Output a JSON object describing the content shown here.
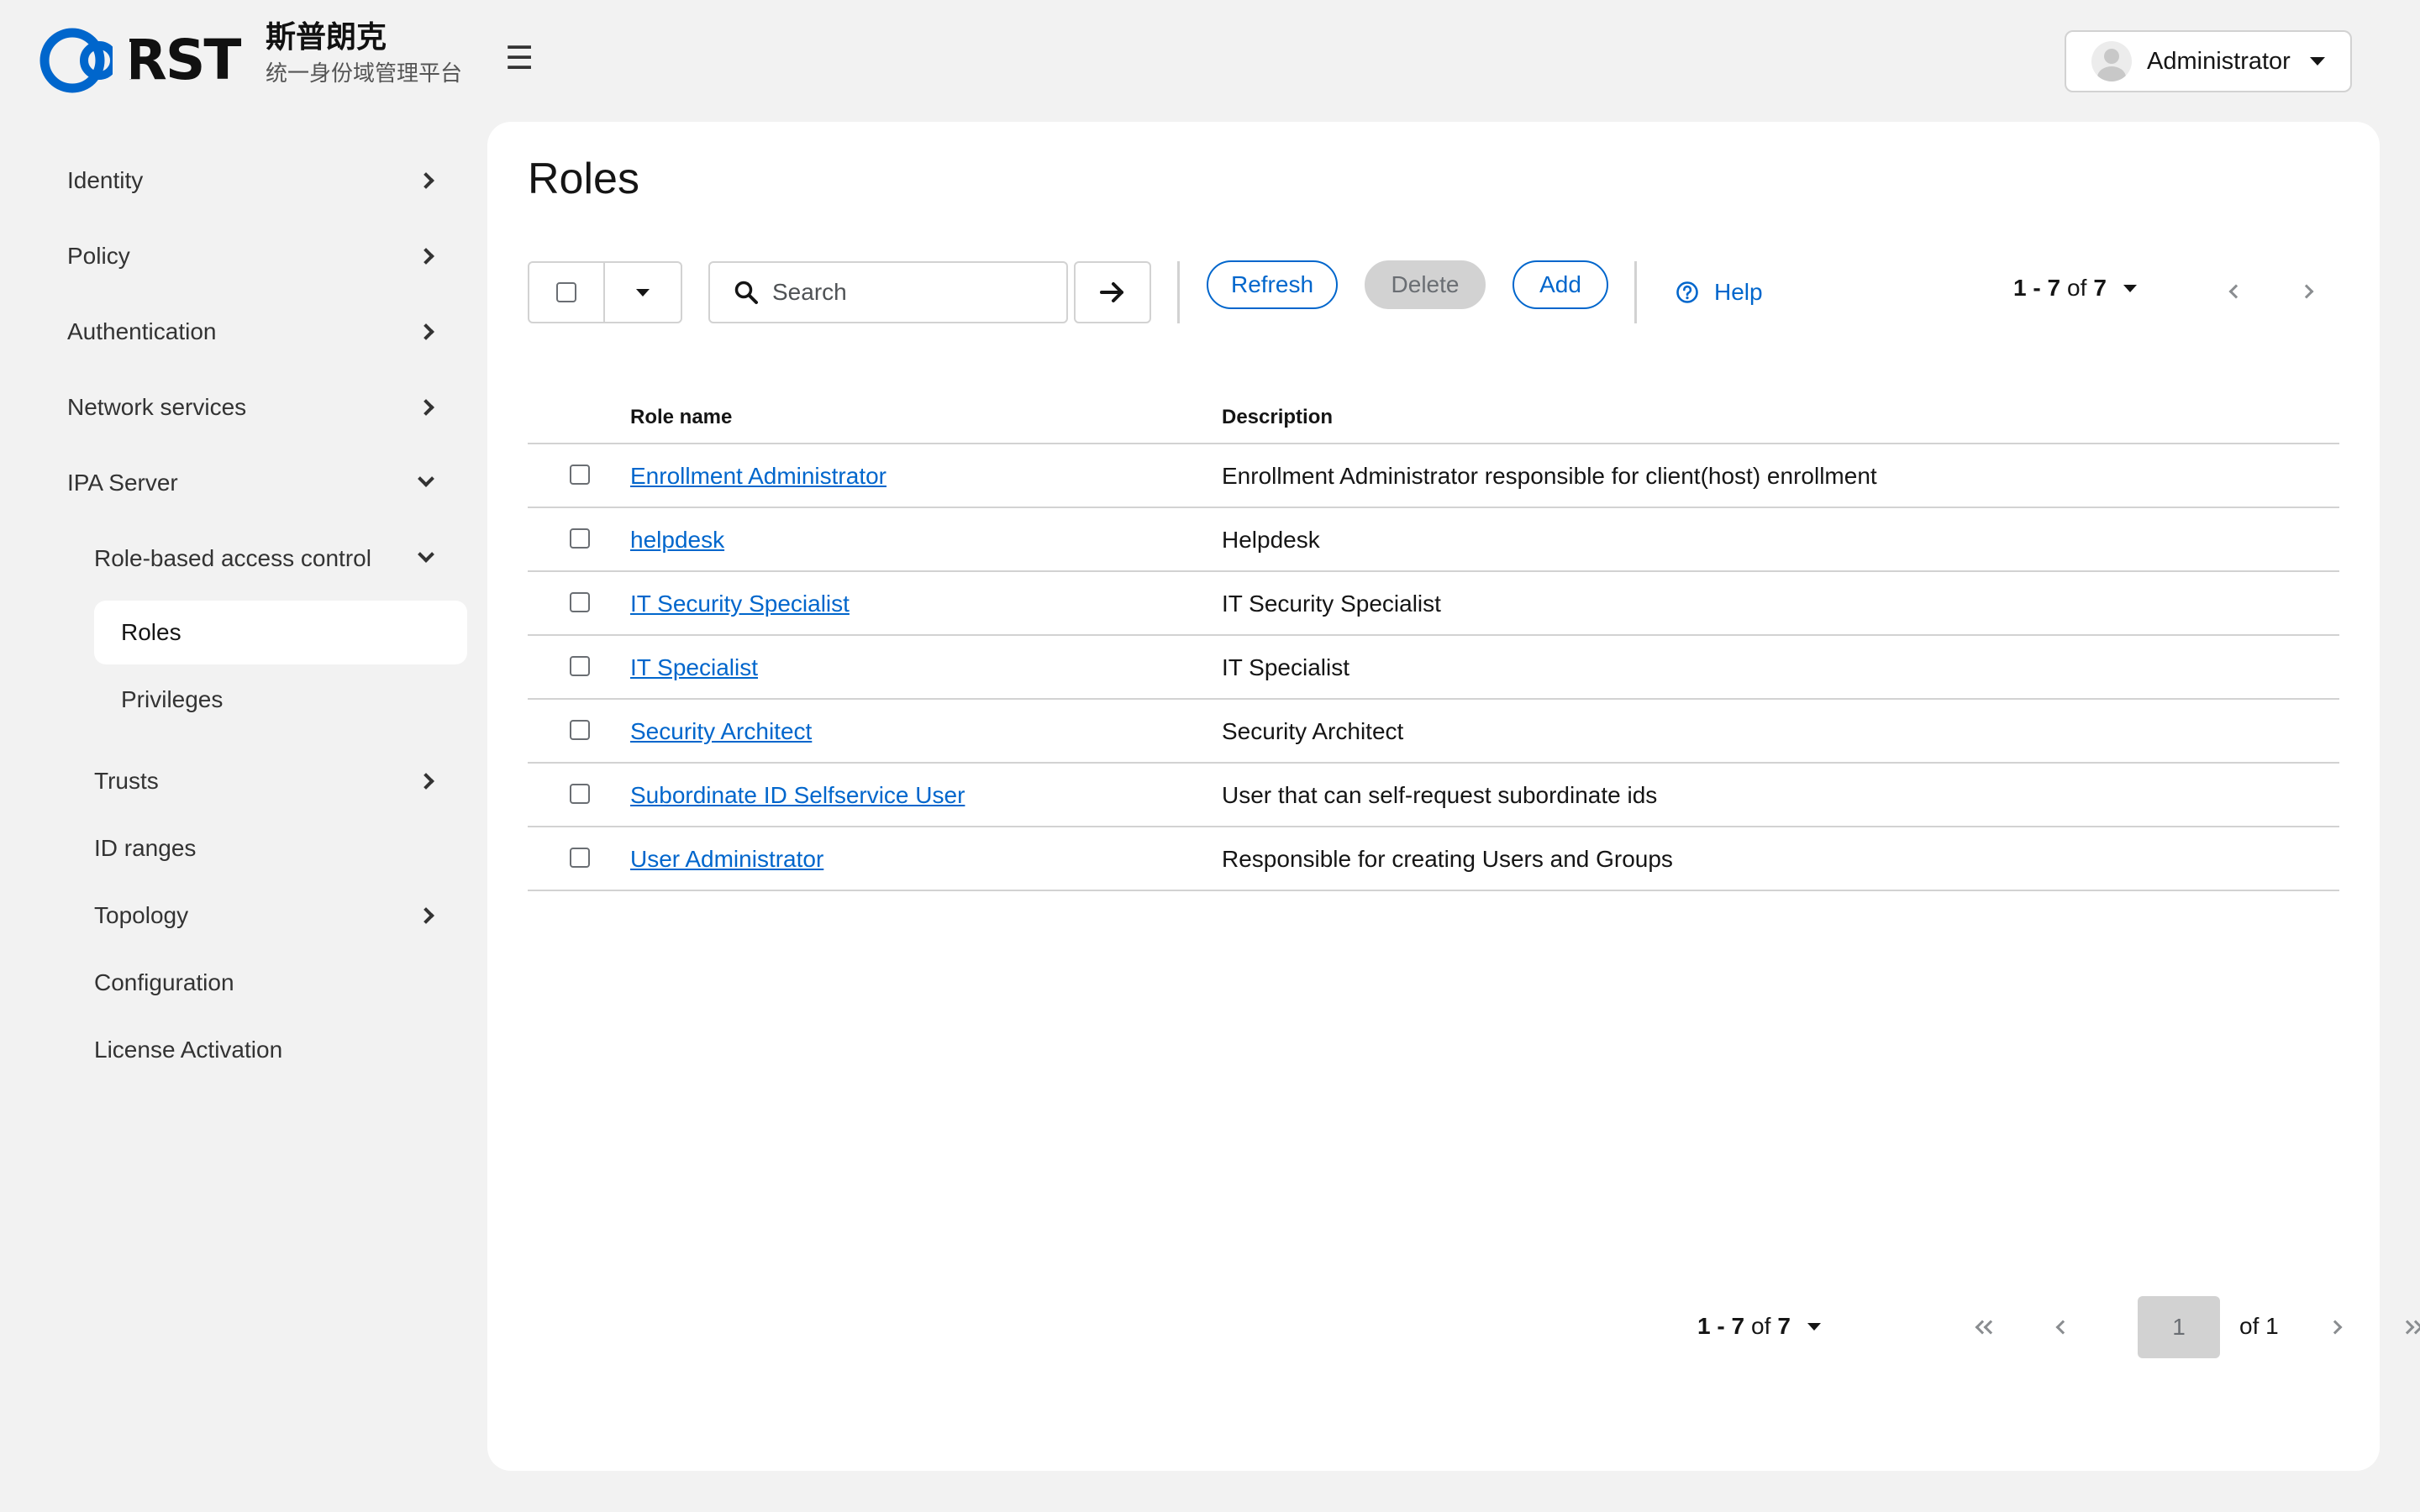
{
  "brand": {
    "letters": "RST",
    "name_cn": "斯普朗克",
    "subtitle_cn": "统一身份域管理平台"
  },
  "header": {
    "user": "Administrator"
  },
  "sidebar": {
    "items": [
      {
        "label": "Identity"
      },
      {
        "label": "Policy"
      },
      {
        "label": "Authentication"
      },
      {
        "label": "Network services"
      },
      {
        "label": "IPA Server"
      },
      {
        "label": "Role-based access control"
      },
      {
        "label": "Roles"
      },
      {
        "label": "Privileges"
      },
      {
        "label": "Trusts"
      },
      {
        "label": "ID ranges"
      },
      {
        "label": "Topology"
      },
      {
        "label": "Configuration"
      },
      {
        "label": "License Activation"
      }
    ]
  },
  "main": {
    "title": "Roles",
    "search_placeholder": "Search",
    "buttons": {
      "refresh": "Refresh",
      "delete": "Delete",
      "add": "Add",
      "help": "Help"
    },
    "pagination": {
      "range": "1 - 7",
      "of": "of",
      "total": "7",
      "page": "1",
      "page_of": "of 1"
    },
    "table": {
      "columns": [
        "Role name",
        "Description"
      ],
      "rows": [
        {
          "name": "Enrollment Administrator",
          "description": "Enrollment Administrator responsible for client(host) enrollment"
        },
        {
          "name": "helpdesk",
          "description": "Helpdesk"
        },
        {
          "name": "IT Security Specialist",
          "description": "IT Security Specialist"
        },
        {
          "name": "IT Specialist",
          "description": "IT Specialist"
        },
        {
          "name": "Security Architect",
          "description": "Security Architect"
        },
        {
          "name": "Subordinate ID Selfservice User",
          "description": "User that can self-request subordinate ids"
        },
        {
          "name": "User Administrator",
          "description": "Responsible for creating Users and Groups"
        }
      ]
    }
  },
  "colors": {
    "accent": "#0066cc",
    "page_background": "#f2f2f2",
    "card_background": "#ffffff",
    "disabled": "#d2d2d2"
  },
  "icons": [
    "brand-logo-icon",
    "menu-icon",
    "avatar-icon",
    "caret-down-icon",
    "chevron-right-icon",
    "chevron-down-icon",
    "search-icon",
    "arrow-right-icon",
    "help-icon",
    "chevron-left-icon",
    "double-chevron-left-icon",
    "double-chevron-right-icon"
  ]
}
